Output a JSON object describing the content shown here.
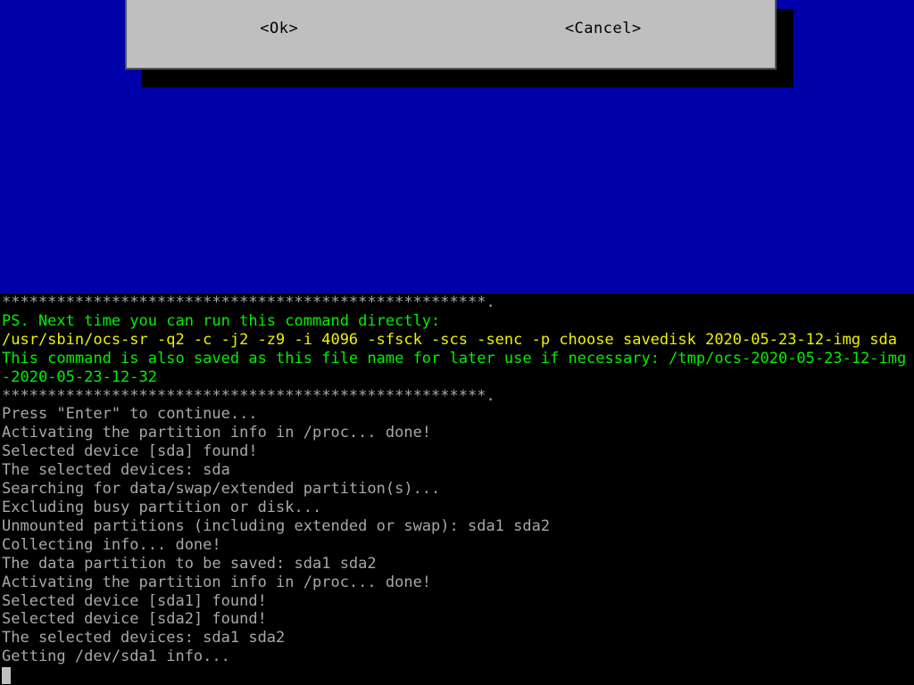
{
  "dialog": {
    "ok_label": "<Ok>",
    "cancel_label": "<Cancel>"
  },
  "terminal": {
    "separator": "*****************************************************.",
    "green_lines": [
      "PS. Next time you can run this command directly:"
    ],
    "yellow_lines": [
      "/usr/sbin/ocs-sr -q2 -c -j2 -z9 -i 4096 -sfsck -scs -senc -p choose savedisk 2020-05-23-12-img sda"
    ],
    "green_lines2": [
      "This command is also saved as this file name for later use if necessary: /tmp/ocs-2020-05-23-12-img-2020-05-23-12-32"
    ],
    "grey_lines": [
      "Press \"Enter\" to continue...",
      "Activating the partition info in /proc... done!",
      "Selected device [sda] found!",
      "The selected devices: sda",
      "Searching for data/swap/extended partition(s)...",
      "Excluding busy partition or disk...",
      "Unmounted partitions (including extended or swap): sda1 sda2",
      "Collecting info... done!",
      "The data partition to be saved: sda1 sda2",
      "Activating the partition info in /proc... done!",
      "Selected device [sda1] found!",
      "Selected device [sda2] found!",
      "The selected devices: sda1 sda2",
      "Getting /dev/sda1 info..."
    ]
  }
}
